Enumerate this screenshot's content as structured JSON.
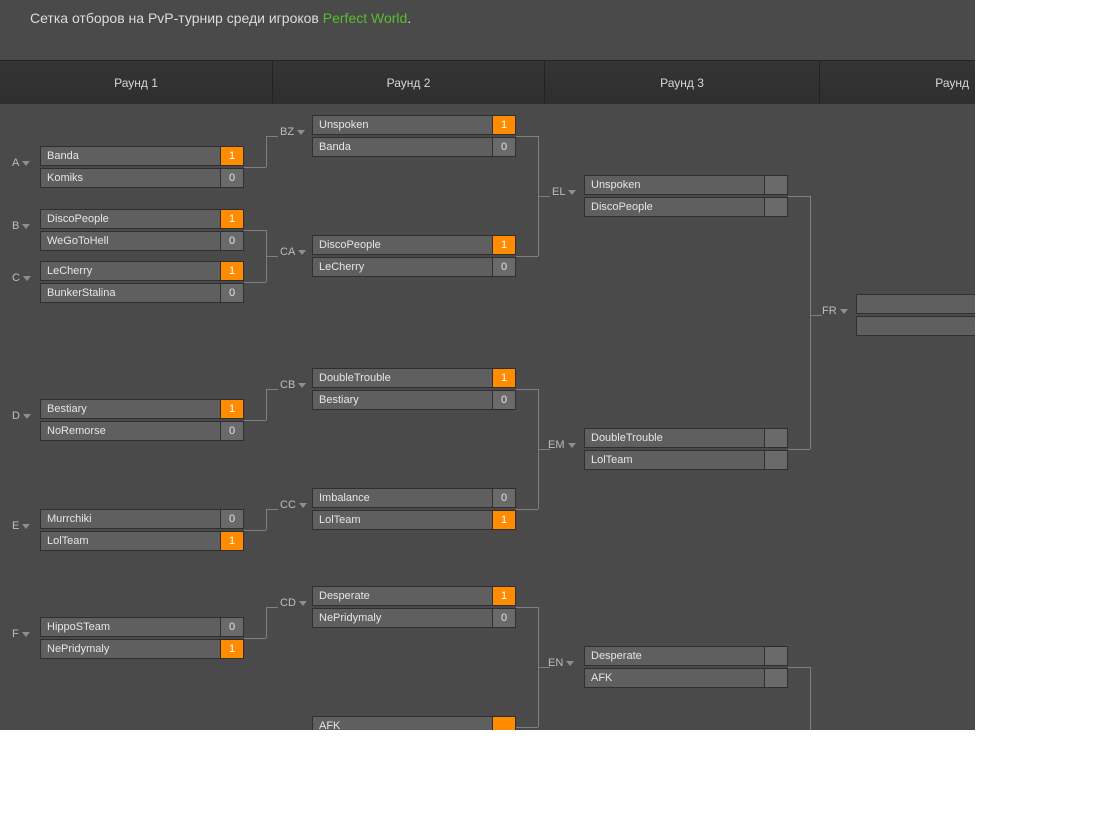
{
  "title_pre": "Сетка отборов на PvP-турнир  среди игроков ",
  "title_hl": "Perfect World",
  "title_post": ".",
  "rounds": {
    "r1": "Раунд 1",
    "r2": "Раунд 2",
    "r3": "Раунд 3",
    "r4": "Раунд"
  },
  "labels": {
    "A": "A",
    "B": "B",
    "C": "C",
    "D": "D",
    "E": "E",
    "F": "F",
    "BZ": "BZ",
    "CA": "CA",
    "CB": "CB",
    "CC": "CC",
    "CD": "CD",
    "EL": "EL",
    "EM": "EM",
    "EN": "EN",
    "FR": "FR"
  },
  "m": {
    "A": {
      "t1": "Banda",
      "s1": "1",
      "t2": "Komiks",
      "s2": "0"
    },
    "B": {
      "t1": "DiscoPeople",
      "s1": "1",
      "t2": "WeGoToHell",
      "s2": "0"
    },
    "C": {
      "t1": "LeCherry",
      "s1": "1",
      "t2": "BunkerStalina",
      "s2": "0"
    },
    "D": {
      "t1": "Bestiary",
      "s1": "1",
      "t2": "NoRemorse",
      "s2": "0"
    },
    "E": {
      "t1": "Murrchiki",
      "s1": "0",
      "t2": "LolTeam",
      "s2": "1"
    },
    "F": {
      "t1": "HippoSTeam",
      "s1": "0",
      "t2": "NePridymaly",
      "s2": "1"
    },
    "BZ": {
      "t1": "Unspoken",
      "s1": "1",
      "t2": "Banda",
      "s2": "0"
    },
    "CA": {
      "t1": "DiscoPeople",
      "s1": "1",
      "t2": "LeCherry",
      "s2": "0"
    },
    "CB": {
      "t1": "DoubleTrouble",
      "s1": "1",
      "t2": "Bestiary",
      "s2": "0"
    },
    "CC": {
      "t1": "Imbalance",
      "s1": "0",
      "t2": "LolTeam",
      "s2": "1"
    },
    "CD": {
      "t1": "Desperate",
      "s1": "1",
      "t2": "NePridymaly",
      "s2": "0"
    },
    "CE": {
      "t1": "AFK",
      "s1": "",
      "t2": "",
      "s2": ""
    },
    "EL": {
      "t1": "Unspoken",
      "s1": "",
      "t2": "DiscoPeople",
      "s2": ""
    },
    "EM": {
      "t1": "DoubleTrouble",
      "s1": "",
      "t2": "LolTeam",
      "s2": ""
    },
    "EN": {
      "t1": "Desperate",
      "s1": "",
      "t2": "AFK",
      "s2": ""
    },
    "FR": {
      "t1": "",
      "s1": "",
      "t2": "",
      "s2": ""
    }
  }
}
